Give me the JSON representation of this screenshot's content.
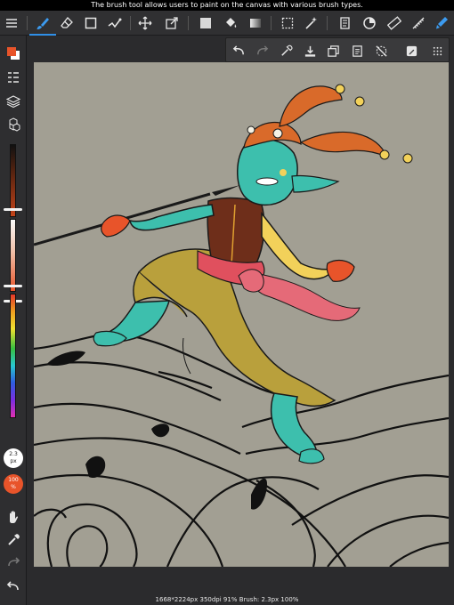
{
  "tooltip": "The brush tool allows users to paint on the canvas with various brush types.",
  "status_bar": "1668*2224px 350dpi 91% Brush: 2.3px 100%",
  "brush": {
    "size_value": "2.3",
    "size_unit": "px",
    "opacity_value": "100",
    "opacity_unit": "%"
  },
  "colors": {
    "accent": "#2f8fe8",
    "foreground": "#e8542a",
    "background": "#ffffff",
    "canvas": "#a29f93"
  },
  "toolbar": {
    "tools": [
      "menu-icon",
      "brush-icon",
      "eraser-icon",
      "shape-icon",
      "fill-icon",
      "move-icon",
      "transform-icon",
      "color-fill-icon",
      "bucket-icon",
      "gradient-icon",
      "select-icon",
      "magic-wand-icon",
      "select-pen-icon",
      "layers-stack-icon",
      "text-icon",
      "ruler-icon",
      "brush-active-icon"
    ],
    "active_tool": "brush"
  },
  "subtoolbar": {
    "tools": [
      "undo-icon",
      "redo-icon",
      "eyedropper-icon",
      "save-icon",
      "copy-icon",
      "paste-icon",
      "no-snap-icon",
      "edit-icon",
      "grid-icon"
    ]
  },
  "sidebar": {
    "tools": [
      "color-swatch-icon",
      "layer-list-icon",
      "layers-icon",
      "materials-icon",
      "hand-icon",
      "eyedropper-icon",
      "redo-icon",
      "undo-icon"
    ]
  }
}
